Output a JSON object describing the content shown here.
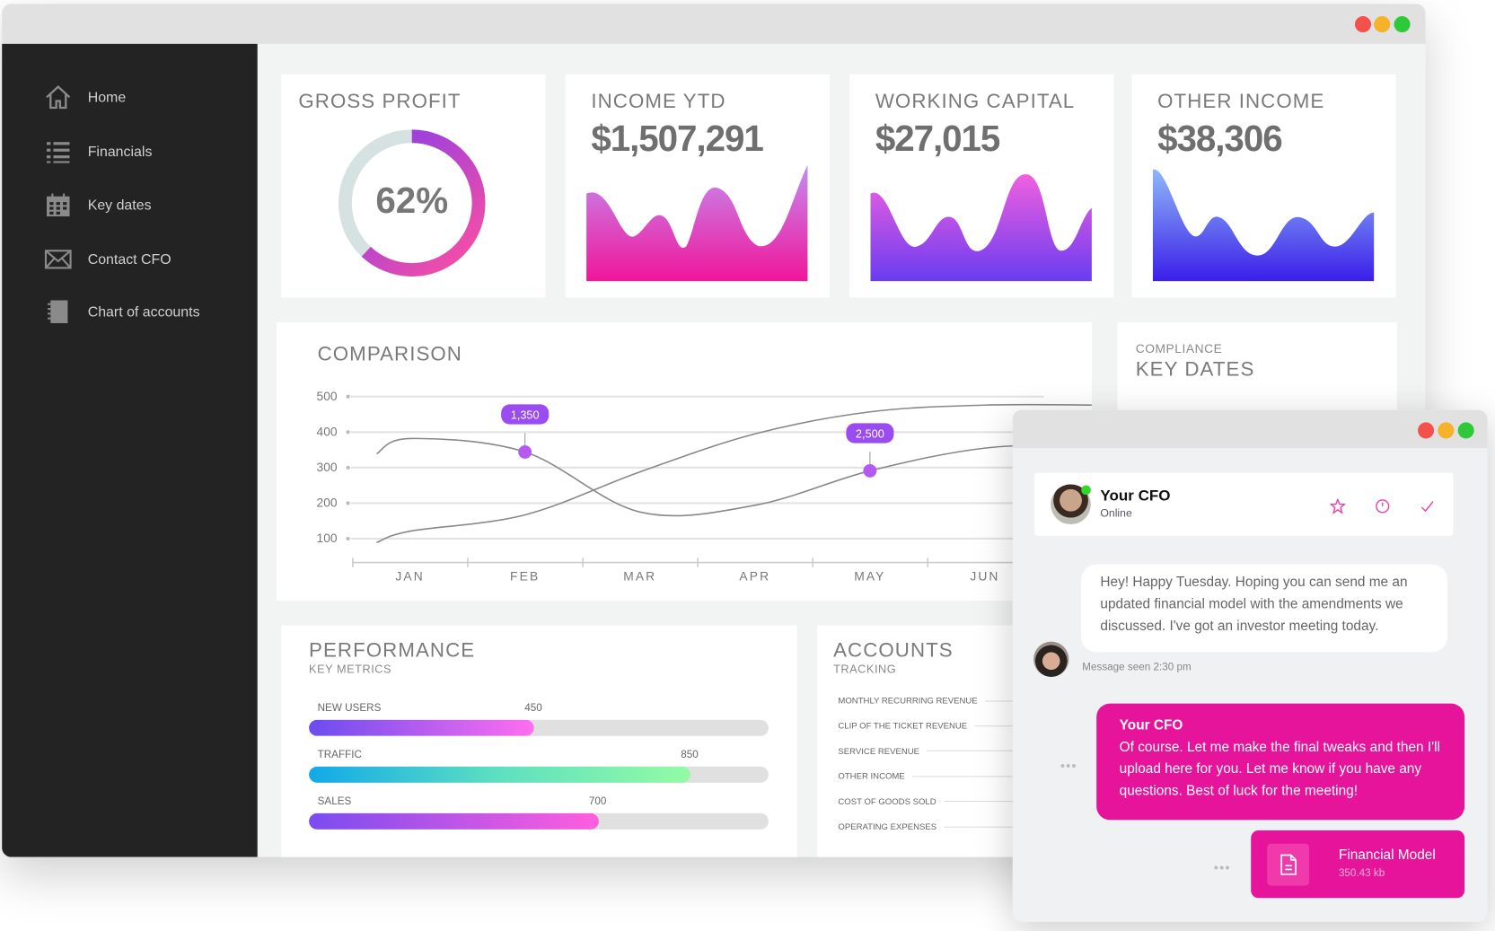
{
  "window_controls": {
    "close_color": "#f4514d",
    "minimize_color": "#f5b22a",
    "maximize_color": "#2fc83a"
  },
  "sidebar": {
    "items": [
      {
        "label": "Home",
        "icon": "home-icon"
      },
      {
        "label": "Financials",
        "icon": "list-icon"
      },
      {
        "label": "Key dates",
        "icon": "calendar-icon"
      },
      {
        "label": "Contact CFO",
        "icon": "mail-icon"
      },
      {
        "label": "Chart of accounts",
        "icon": "notebook-icon"
      }
    ]
  },
  "kpis": {
    "gross_profit": {
      "title": "GROSS PROFIT",
      "value": "62%",
      "percent": 62
    },
    "income_ytd": {
      "title": "INCOME YTD",
      "value": "$1,507,291"
    },
    "working_capital": {
      "title": "WORKING CAPITAL",
      "value": "$27,015"
    },
    "other_income": {
      "title": "OTHER INCOME",
      "value": "$38,306"
    }
  },
  "comparison": {
    "title": "COMPARISON"
  },
  "chart_data": {
    "type": "line",
    "title": "COMPARISON",
    "categories": [
      "JAN",
      "FEB",
      "MAR",
      "APR",
      "MAY",
      "JUN"
    ],
    "y_ticks": [
      "500",
      "400",
      "300",
      "200",
      "100"
    ],
    "ylim": [
      100,
      500
    ],
    "grid": true,
    "series": [
      {
        "values": [
          382,
          344,
          175,
          194,
          291,
          355
        ]
      },
      {
        "values": [
          121,
          167,
          288,
          395,
          457,
          476
        ]
      }
    ],
    "annotations": [
      {
        "category": "FEB",
        "series": 0,
        "label": "1,350"
      },
      {
        "category": "MAY",
        "series": 0,
        "label": "2,500"
      }
    ]
  },
  "compliance": {
    "subtitle": "COMPLIANCE",
    "title": "KEY DATES"
  },
  "performance": {
    "title": "PERFORMANCE",
    "subtitle": "KEY METRICS",
    "metrics": [
      {
        "label": "NEW USERS",
        "value": "450",
        "fill_percent": 49
      },
      {
        "label": "TRAFFIC",
        "value": "850",
        "fill_percent": 83
      },
      {
        "label": "SALES",
        "value": "700",
        "fill_percent": 63
      }
    ]
  },
  "accounts": {
    "title": "ACCOUNTS",
    "subtitle": "TRACKING",
    "items": [
      "MONTHLY RECURRING REVENUE",
      "CLIP OF THE TICKET REVENUE",
      "SERVICE REVENUE",
      "OTHER INCOME",
      "COST OF GOODS SOLD",
      "OPERATING EXPENSES"
    ]
  },
  "chat": {
    "contact_name": "Your CFO",
    "status": "Online",
    "incoming": "Hey! Happy Tuesday. Hoping you can send me an updated financial model with the amendments we discussed. I've got an investor meeting today.",
    "seen": "Message seen 2:30 pm",
    "reply_sender": "Your CFO",
    "reply": "Of course. Let me make the final tweaks and then I'll upload here for you. Let me know if you have any questions. Best of luck for the meeting!",
    "file_name": "Financial Model",
    "file_size": "350.43 kb",
    "accent": "#e6149a"
  }
}
